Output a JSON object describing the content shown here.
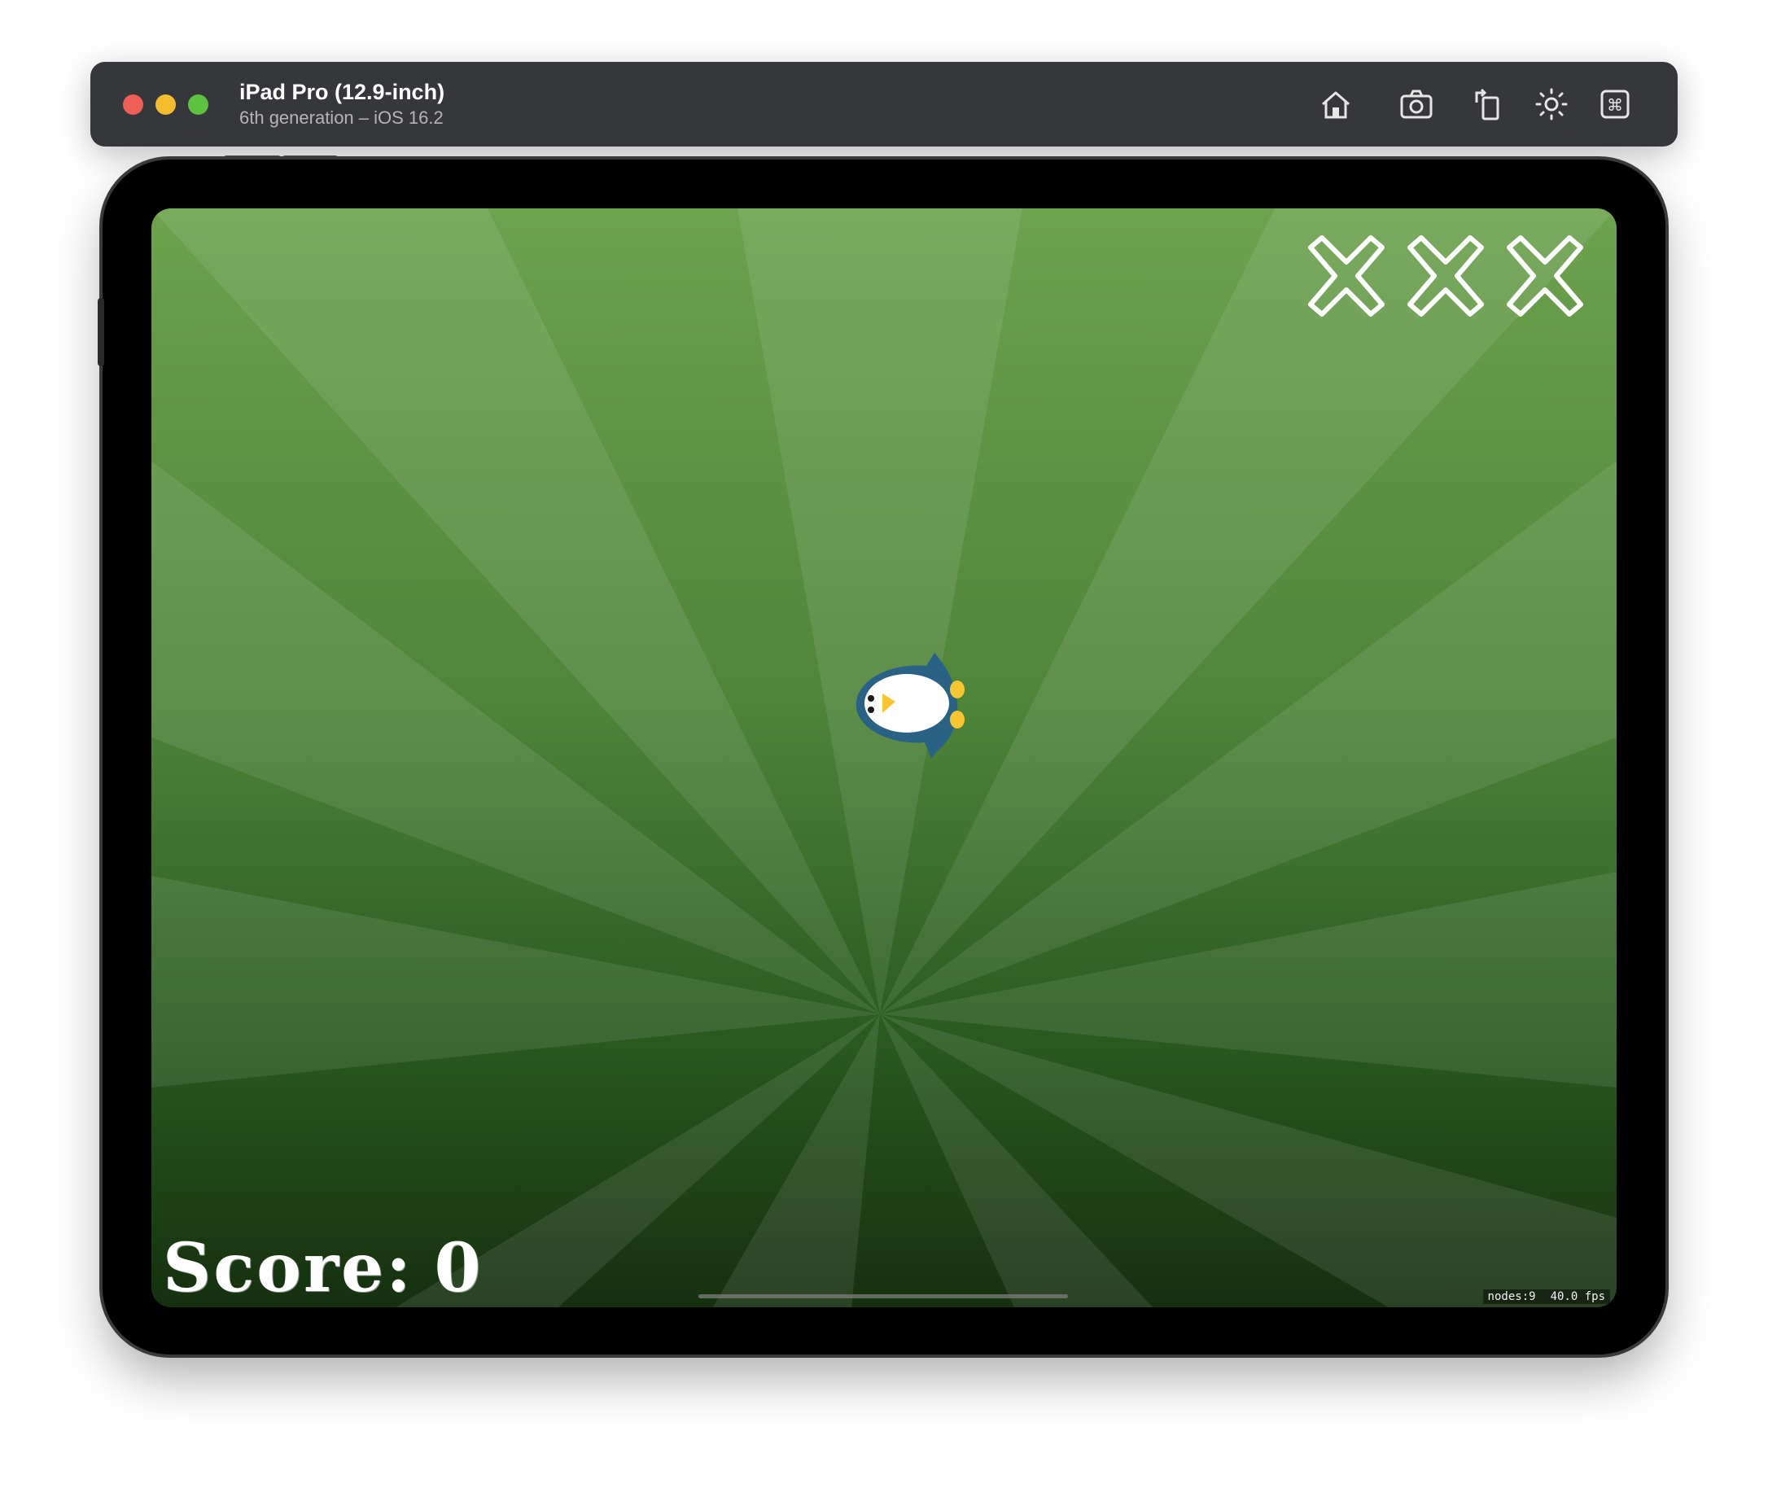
{
  "simulator": {
    "device_name": "iPad Pro (12.9-inch)",
    "device_subtitle": "6th generation – iOS 16.2",
    "toolbar_icons": [
      "home-icon",
      "screenshot-icon",
      "rotate-icon",
      "appearance-icon",
      "command-icon"
    ]
  },
  "game": {
    "score_label": "Score:",
    "score_value": "0",
    "lives_remaining_markers": 3,
    "stats": {
      "nodes": "nodes:9",
      "fps": "40.0 fps"
    }
  },
  "colors": {
    "titlebar": "#36373b",
    "bg_top": "#6da24e",
    "bg_bottom": "#15300f",
    "penguin_body": "#2a6286",
    "penguin_feet": "#f6c531"
  }
}
